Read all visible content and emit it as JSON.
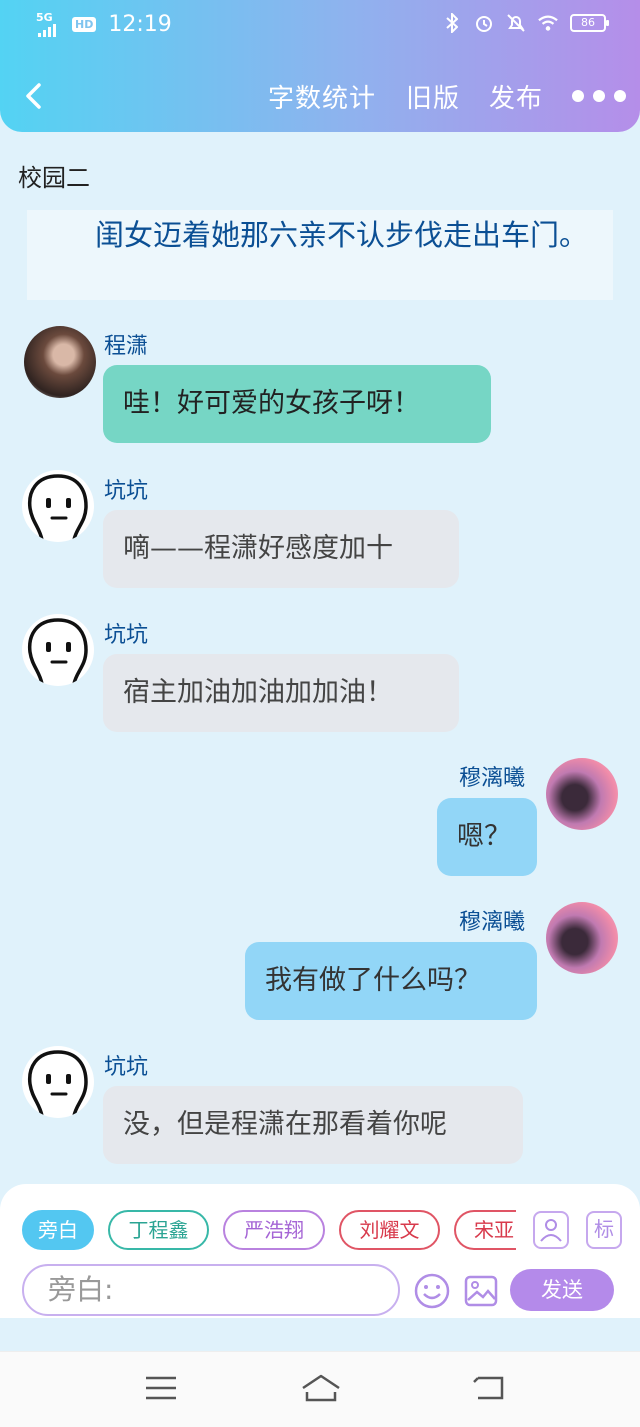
{
  "status_bar": {
    "network": "5G",
    "hd": "HD",
    "time": "12:19",
    "battery": "86"
  },
  "header": {
    "back_icon": "chevron-left-icon",
    "word_count": "字数统计",
    "old_version": "旧版",
    "publish": "发布",
    "more_icon": "more-dots-icon"
  },
  "chat": {
    "title": "校园二",
    "narration": "闺女迈着她那六亲不认步伐走出车门。",
    "messages": [
      {
        "side": "left",
        "sender": "程潇",
        "text": "哇！好可爱的女孩子呀！",
        "bubble_color": "#76d6c5",
        "avatar": "photo-avatar"
      },
      {
        "side": "left",
        "sender": "坑坑",
        "text": "嘀——程潇好感度加十",
        "bubble_color": "#e5e8ed",
        "avatar": "doodle-face-avatar"
      },
      {
        "side": "left",
        "sender": "坑坑",
        "text": "宿主加油加油加加油！",
        "bubble_color": "#e5e8ed",
        "avatar": "doodle-face-avatar"
      },
      {
        "side": "right",
        "sender": "穆漓曦",
        "text": "嗯？",
        "bubble_color": "#92d6f7",
        "avatar": "photo-avatar"
      },
      {
        "side": "right",
        "sender": "穆漓曦",
        "text": "我有做了什么吗？",
        "bubble_color": "#92d6f7",
        "avatar": "photo-avatar"
      },
      {
        "side": "left",
        "sender": "坑坑",
        "text": "没，但是程潇在那看着你呢",
        "bubble_color": "#e5e8ed",
        "avatar": "doodle-face-avatar"
      }
    ]
  },
  "composer": {
    "role_chips": [
      "旁白",
      "丁程鑫",
      "严浩翔",
      "刘耀文",
      "宋亚"
    ],
    "person_icon": "person-card-icon",
    "mark_button": "标",
    "input_placeholder": "旁白:",
    "emoji_icon": "emoji-icon",
    "image_icon": "image-icon",
    "send": "发送"
  },
  "system_nav": {
    "menu_icon": "menu-icon",
    "home_icon": "home-icon",
    "back_icon": "back-icon"
  },
  "colors": {
    "accent": "#b48aea",
    "header_start": "#53d3f3",
    "header_end": "#b58ee9",
    "name_text": "#0b4f94"
  }
}
